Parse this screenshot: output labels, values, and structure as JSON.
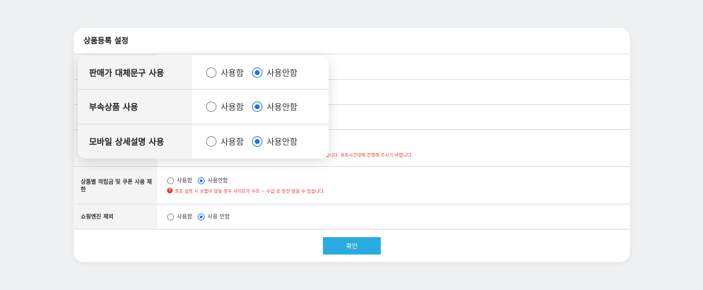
{
  "card": {
    "title": "상품등록 설정"
  },
  "rows": [
    {
      "label": "상품별 적립금 및 쿠폰 사용 제한",
      "options": [
        "사용함",
        "사용안함"
      ],
      "selected": 1,
      "warning": "최초 설정 시 상품이 많을 경우 사이트가 수초 ~ 수십 초 동안 멈출 수 있습니다."
    },
    {
      "label": "쇼핑엔진 제외",
      "options": [
        "사용함",
        "사용 안함"
      ],
      "selected": 1
    }
  ],
  "partial_warning": "습니다. 휴휴시간대에 진행해 주시기 바랍니다.",
  "confirm_label": "확인",
  "popup": {
    "rows": [
      {
        "label": "판매가 대체문구 사용",
        "options": [
          "사용함",
          "사용안함"
        ],
        "selected": 1
      },
      {
        "label": "부속상품 사용",
        "options": [
          "사용함",
          "사용안함"
        ],
        "selected": 1
      },
      {
        "label": "모바일 상세설명 사용",
        "options": [
          "사용함",
          "사용안함"
        ],
        "selected": 1
      }
    ]
  },
  "colors": {
    "accent": "#1a73e8",
    "button": "#29abe2",
    "warning": "#e53935",
    "background": "#eef0f2"
  }
}
